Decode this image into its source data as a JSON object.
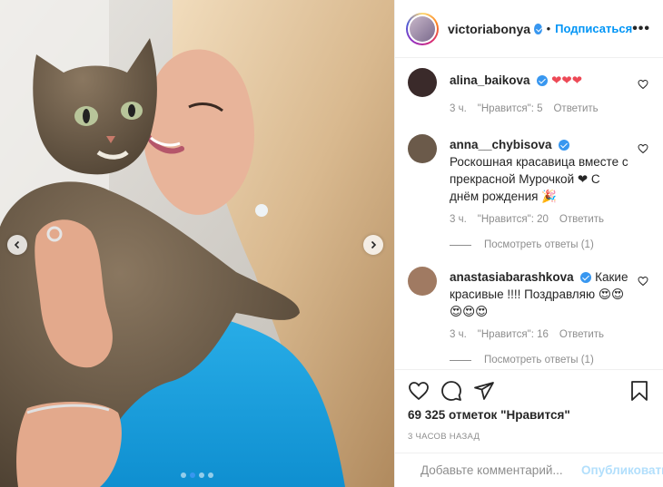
{
  "post": {
    "author": "victoriabonya",
    "follow_label": "Подписаться",
    "separator": "•",
    "more_label": "•••",
    "carousel": {
      "slides": 4,
      "active": 1
    }
  },
  "comments": [
    {
      "user": "alina_baikova",
      "text": "❤❤❤",
      "time": "3 ч.",
      "likes": "\"Нравится\": 5",
      "reply": "Ответить",
      "avatar_color": "#3a2a2a"
    },
    {
      "user": "anna__chybisova",
      "text": "Роскошная красавица вместе с прекрасной Мурочкой ❤ С днём рождения 🎉",
      "time": "3 ч.",
      "likes": "\"Нравится\": 20",
      "reply": "Ответить",
      "view_replies": "Посмотреть ответы (1)",
      "avatar_color": "#6b5a4a"
    },
    {
      "user": "anastasiabarashkova",
      "text": "Какие красивые !!!! Поздравляю 😍😍 😍😍😍",
      "time": "3 ч.",
      "likes": "\"Нравится\": 16",
      "reply": "Ответить",
      "view_replies": "Посмотреть ответы (1)",
      "avatar_color": "#a07a62"
    }
  ],
  "footer": {
    "likes_count": "69 325 отметок \"Нравится\"",
    "posted_time": "3 ЧАСОВ НАЗАД",
    "comment_placeholder": "Добавьте комментарий...",
    "publish_label": "Опубликовать"
  },
  "colors": {
    "accent": "#0095f6",
    "verified": "#3897f0",
    "heart": "#ed4956",
    "muted": "#8e8e8e"
  }
}
